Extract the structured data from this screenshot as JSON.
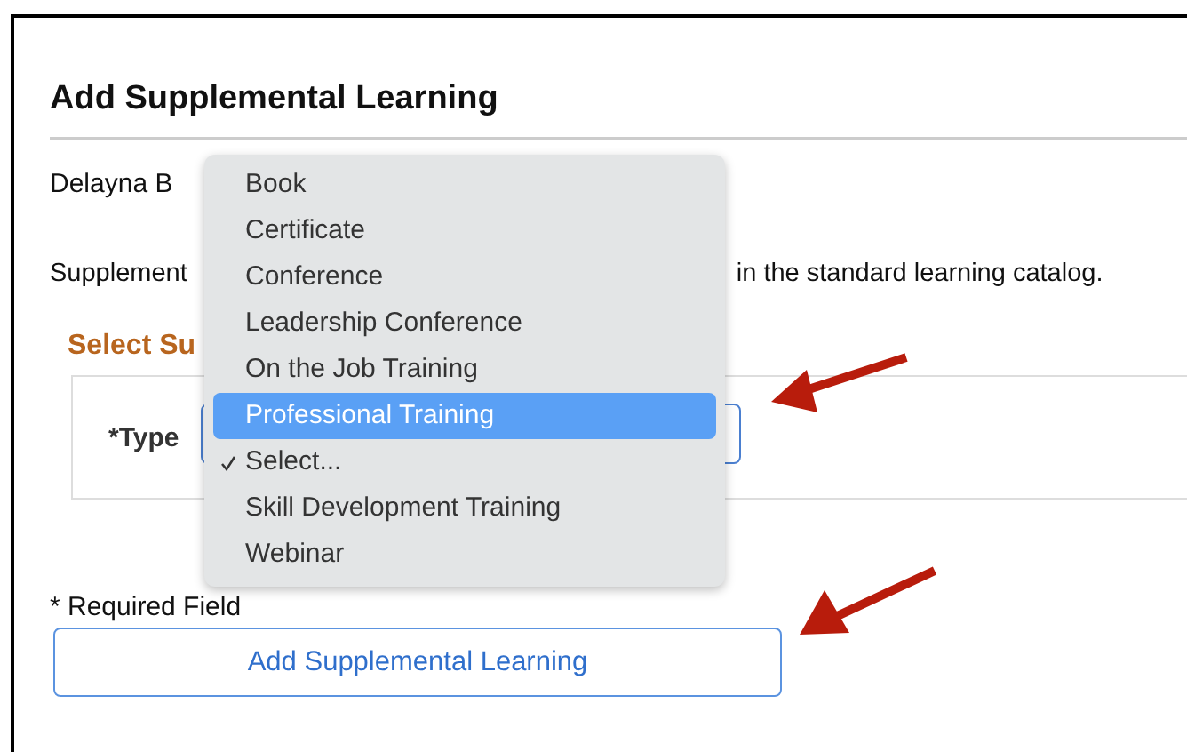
{
  "page": {
    "title": "Add Supplemental Learning",
    "person_name": "Delayna B",
    "intro_start": "Supplement",
    "intro_end": "in the standard learning catalog.",
    "section_title": "Select Su",
    "type_label": "*Type",
    "required_note": "* Required Field",
    "submit_button": "Add Supplemental Learning"
  },
  "dropdown": {
    "items": [
      {
        "label": "Book",
        "selected": false,
        "checked": false
      },
      {
        "label": "Certificate",
        "selected": false,
        "checked": false
      },
      {
        "label": "Conference",
        "selected": false,
        "checked": false
      },
      {
        "label": "Leadership Conference",
        "selected": false,
        "checked": false
      },
      {
        "label": "On the Job Training",
        "selected": false,
        "checked": false
      },
      {
        "label": "Professional Training",
        "selected": true,
        "checked": false
      },
      {
        "label": "Select...",
        "selected": false,
        "checked": true
      },
      {
        "label": "Skill Development Training",
        "selected": false,
        "checked": false
      },
      {
        "label": "Webinar",
        "selected": false,
        "checked": false
      }
    ]
  }
}
